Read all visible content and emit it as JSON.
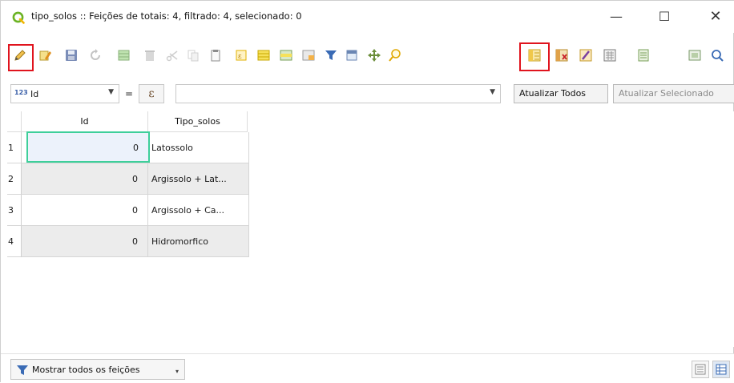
{
  "window": {
    "title": "tipo_solos :: Feições de totais: 4, filtrado: 4, selecionado: 0",
    "app_icon": "qgis-q-icon",
    "controls": {
      "minimize": "—",
      "maximize": "☐",
      "close": "✕"
    }
  },
  "toolbar": {
    "icons": [
      "toggle-editing-icon",
      "multi-edit-icon",
      "save-edits-icon",
      "reload-table-icon",
      "add-feature-icon",
      "delete-selected-icon",
      "cut-icon",
      "copy-icon",
      "paste-icon",
      "expression-select-icon",
      "select-all-icon",
      "invert-selection-icon",
      "deselect-all-icon",
      "filter-selected-icon",
      "move-selected-top-icon",
      "pan-to-selected-icon",
      "zoom-to-selected-icon",
      "new-field-icon",
      "delete-field-icon",
      "organize-columns-icon",
      "field-calculator-icon",
      "conditional-format-icon",
      "actions-icon",
      "dock-icon"
    ],
    "highlighted": [
      "toggle-editing-icon",
      "new-field-icon"
    ],
    "highlight_color": "#e0141e"
  },
  "filter_bar": {
    "field_type_badge": "123",
    "field_name": "Id",
    "operator": "=",
    "expression_symbol": "ε",
    "value": "",
    "update_all": "Atualizar Todos",
    "update_selected": "Atualizar Selecionado"
  },
  "table": {
    "columns": [
      "Id",
      "Tipo_solos"
    ],
    "rows": [
      {
        "num": "1",
        "id": "0",
        "tipo": "Latossolo"
      },
      {
        "num": "2",
        "id": "0",
        "tipo": "Argissolo + Lat..."
      },
      {
        "num": "3",
        "id": "0",
        "tipo": "Argissolo + Ca..."
      },
      {
        "num": "4",
        "id": "0",
        "tipo": "Hidromorfico"
      }
    ],
    "current_cell_color": "#3ecf9a"
  },
  "bottom_bar": {
    "show_all": "Mostrar todos os feições",
    "form_view_icon": "form-view-icon",
    "table_view_icon": "table-view-icon"
  }
}
